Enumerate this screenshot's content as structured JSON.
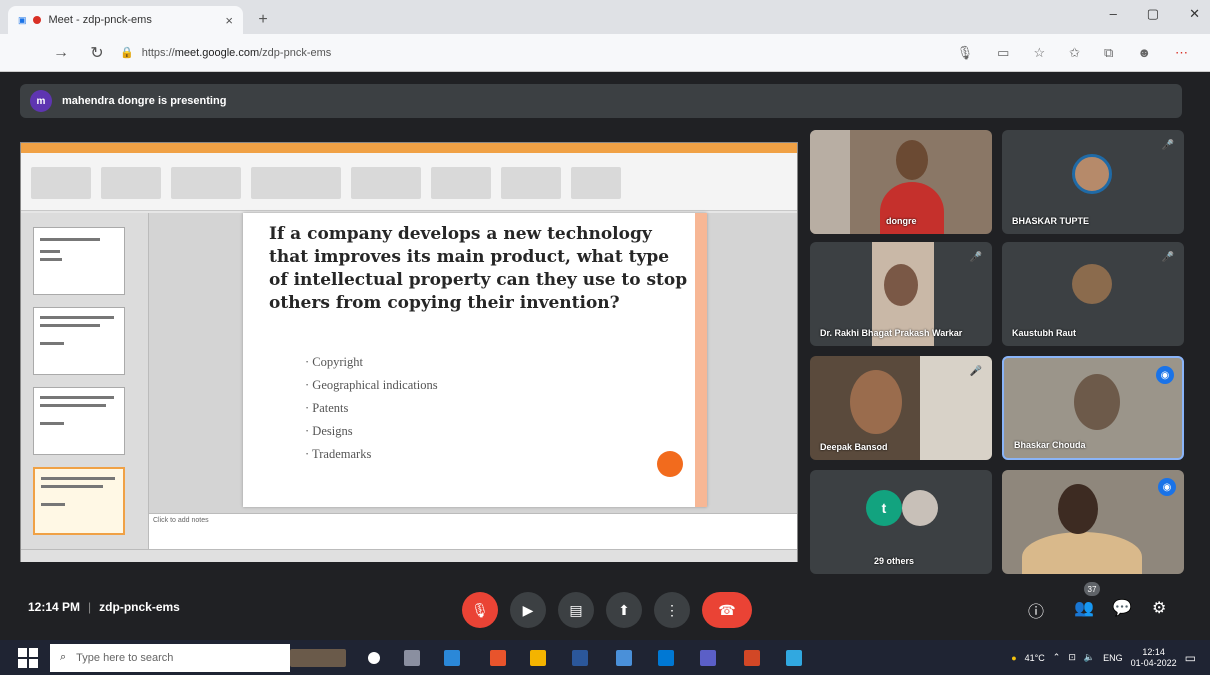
{
  "browser": {
    "tab_title": "Meet - zdp-pnck-ems",
    "tab_close": "×",
    "new_tab": "+",
    "window_controls": [
      "–",
      "▢",
      "✕"
    ],
    "url_host": "meet.google.com",
    "url_prefix": "https://",
    "url_path": "/zdp-pnck-ems",
    "extension_icons": [
      "mic-icon",
      "cast-icon",
      "star-icon",
      "bookmark-icon",
      "collections-icon",
      "profile-icon",
      "more-icon"
    ]
  },
  "meet": {
    "presenter_initial": "m",
    "presenter_banner": "mahendra dongre is presenting",
    "time": "12:14 PM",
    "meeting_code": "zdp-pnck-ems",
    "people_count": "37",
    "others_label": "29 others",
    "participants": [
      {
        "name": "dongre"
      },
      {
        "name": "BHASKAR TUPTE"
      },
      {
        "name": "Dr. Rakhi Bhagat Prakash Warkar"
      },
      {
        "name": "Kaustubh Raut"
      },
      {
        "name": "Deepak Bansod"
      },
      {
        "name": "Bhaskar Chouda"
      },
      {
        "name": ""
      }
    ]
  },
  "slide": {
    "question": "If a company develops a new technology that improves its main product, what type of intellectual property can they use to stop others from copying their invention?",
    "options": [
      "· Copyright",
      "· Geographical indications",
      "· Patents",
      "· Designs",
      "· Trademarks"
    ],
    "notes_placeholder": "Click to add notes"
  },
  "taskbar": {
    "search_placeholder": "Type here to search",
    "weather": "41°C",
    "lang": "ENG",
    "time": "12:14",
    "date": "01-04-2022"
  },
  "colors": {
    "meet_bg": "#202124",
    "tile_bg": "#3c4043",
    "end_call": "#ea4335",
    "slide_accent": "#f7b795",
    "ppt_accent": "#f0a145"
  }
}
